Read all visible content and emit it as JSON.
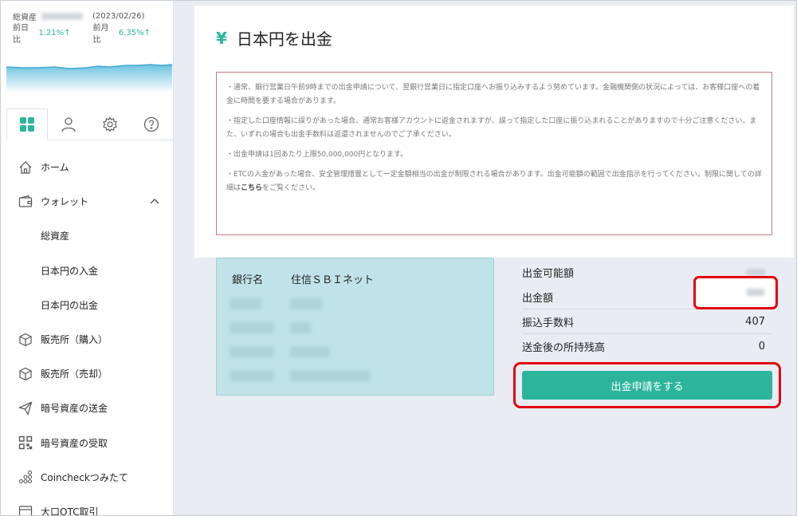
{
  "asset": {
    "label": "総資産",
    "date": "(2023/02/26)",
    "day_label": "前日比",
    "day_value": "1.21%↑",
    "month_label": "前月比",
    "month_value": "6.35%↑"
  },
  "tabs": [
    "dashboard",
    "user",
    "settings",
    "help"
  ],
  "nav": {
    "home": "ホーム",
    "wallet": "ウォレット",
    "total_assets": "総資産",
    "jpy_deposit": "日本円の入金",
    "jpy_withdraw": "日本円の出金",
    "buy": "販売所（購入）",
    "sell": "販売所（売却）",
    "send": "暗号資産の送金",
    "receive": "暗号資産の受取",
    "tsumitate": "Coincheckつみたて",
    "otc": "大口OTC取引"
  },
  "page": {
    "yen_symbol": "¥",
    "title": "日本円を出金"
  },
  "notice": {
    "p1": "・通常、銀行営業日午前9時までの出金申請について、翌銀行営業日に指定口座へお振り込みするよう努めています。金融機関側の状況によっては、お客様口座への着金に時間を要する場合があります。",
    "p2": "・指定した口座情報に誤りがあった場合、通常お客様アカウントに返金されますが、誤って指定した口座に振り込まれることがありますので十分ご注意ください。また、いずれの場合も出金手数料は返還されませんのでご了承ください。",
    "p3": "・出金申請は1回あたり上限50,000,000円となります。",
    "p4_pre": "・ETCの入金があった場合、安全管理措置として一定金額相当の出金が制限される場合があります。出金可能額の範囲で出金指示を行ってください。制限に関しての詳細は",
    "p4_link": "こちら",
    "p4_post": "をご覧ください。"
  },
  "bank": {
    "name_label": "銀行名",
    "name_value": "住信ＳＢＩネット"
  },
  "summary": {
    "available_label": "出金可能額",
    "amount_label": "出金額",
    "fee_label": "振込手数料",
    "fee_value": "407",
    "balance_label": "送金後の所持残高",
    "balance_value": "0"
  },
  "submit_label": "出金申請をする",
  "colors": {
    "accent": "#2cb59b",
    "highlight": "#e2000f",
    "bank_bg": "#bfe3e8",
    "notice_border": "#c77a85"
  }
}
